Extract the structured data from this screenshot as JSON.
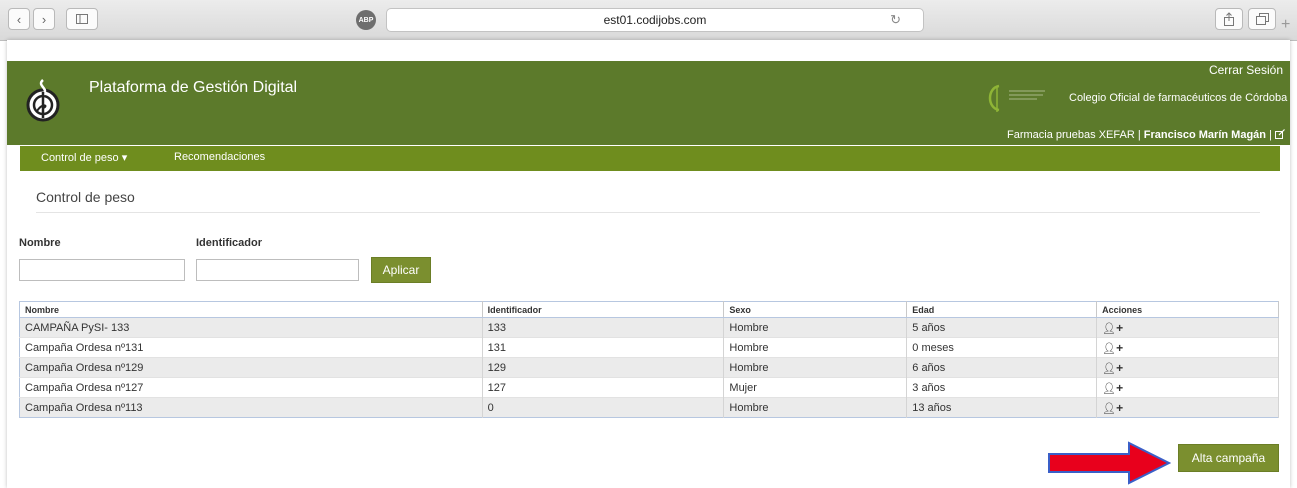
{
  "browser": {
    "url": "est01.codijobs.com",
    "abp_label": "ABP"
  },
  "header": {
    "app_title": "Plataforma de Gestión Digital",
    "logout_label": "Cerrar Sesión",
    "colegio_name": "Colegio Oficial de farmacéuticos de Córdoba",
    "pharmacy": "Farmacia pruebas XEFAR",
    "separator": "|",
    "user_name": "Francisco Marín Magán",
    "user_separator": "|"
  },
  "nav": {
    "items": [
      {
        "label": "Control de peso ▾"
      },
      {
        "label": "Recomendaciones"
      }
    ]
  },
  "page": {
    "title": "Control de peso"
  },
  "filters": {
    "nombre_label": "Nombre",
    "nombre_value": "",
    "identificador_label": "Identificador",
    "identificador_value": "",
    "apply_label": "Aplicar"
  },
  "table": {
    "columns": [
      "Nombre",
      "Identificador",
      "Sexo",
      "Edad",
      "Acciones"
    ],
    "rows": [
      {
        "nombre": "CAMPAÑA PySI- 133",
        "identificador": "133",
        "sexo": "Hombre",
        "edad": "5 años"
      },
      {
        "nombre": "Campaña Ordesa nº131",
        "identificador": "131",
        "sexo": "Hombre",
        "edad": "0 meses"
      },
      {
        "nombre": "Campaña Ordesa nº129",
        "identificador": "129",
        "sexo": "Hombre",
        "edad": "6 años"
      },
      {
        "nombre": "Campaña Ordesa nº127",
        "identificador": "127",
        "sexo": "Mujer",
        "edad": "3 años"
      },
      {
        "nombre": "Campaña Ordesa nº113",
        "identificador": "0",
        "sexo": "Hombre",
        "edad": "13 años"
      }
    ],
    "action_icons": [
      "user-icon",
      "plus-icon"
    ]
  },
  "actions": {
    "alta_label": "Alta campaña"
  },
  "colors": {
    "header_green": "#5c7a2b",
    "nav_green": "#6f8d1e",
    "button_green": "#7b8f2f",
    "arrow_red": "#e8001c",
    "action_blue": "#3d78a8"
  }
}
